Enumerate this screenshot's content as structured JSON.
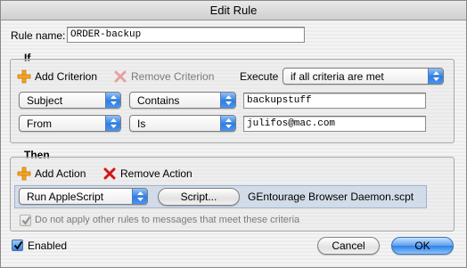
{
  "window": {
    "title": "Edit Rule"
  },
  "rule_name": {
    "label": "Rule name:",
    "value": "ORDER-backup"
  },
  "if_section": {
    "title": "If",
    "add_criterion": "Add Criterion",
    "remove_criterion": "Remove Criterion",
    "execute_label": "Execute",
    "execute_value": "if all criteria are met",
    "criteria": [
      {
        "field": "Subject",
        "operator": "Contains",
        "value": "backupstuff"
      },
      {
        "field": "From",
        "operator": "Is",
        "value": "julifos@mac.com"
      }
    ]
  },
  "then_section": {
    "title": "Then",
    "add_action": "Add Action",
    "remove_action": "Remove Action",
    "action": {
      "type": "Run AppleScript",
      "button": "Script...",
      "script_name": "GEntourage Browser Daemon.scpt"
    },
    "no_other_rules": {
      "label": "Do not apply other rules to messages that meet these criteria",
      "checked": true,
      "enabled": false
    }
  },
  "enabled": {
    "label": "Enabled",
    "checked": true
  },
  "buttons": {
    "cancel": "Cancel",
    "ok": "OK"
  },
  "colors": {
    "accent": "#2e7fe6",
    "add_icon": "#f5a623",
    "remove_icon": "#d0161b"
  }
}
